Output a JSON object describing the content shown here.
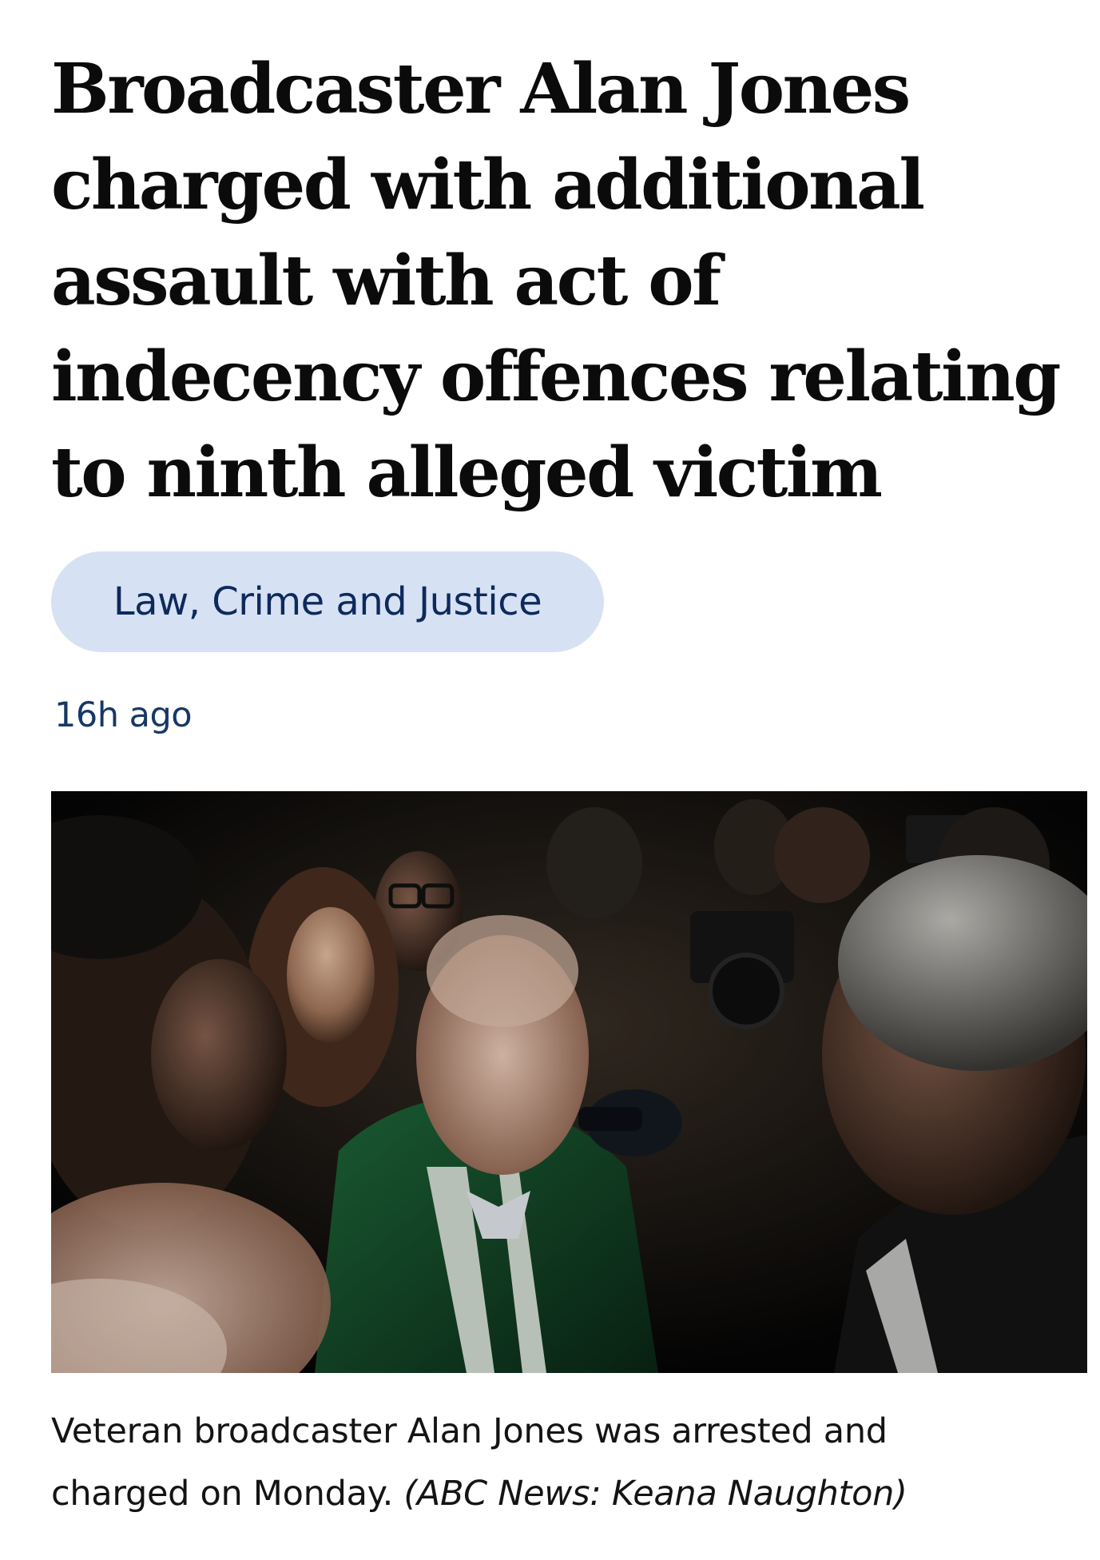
{
  "headline": {
    "lines": [
      "Broadcaster Alan Jones",
      "charged with additional",
      "assault with act of",
      "indecency offences relating",
      "to ninth alleged victim"
    ]
  },
  "topic_tag": {
    "label": "Law, Crime and Justice"
  },
  "timestamp": "16h ago",
  "photo": {
    "alt_subject": "news-photo"
  },
  "caption": {
    "line1": "Veteran broadcaster Alan Jones was arrested and",
    "line2_text": "charged on Monday.",
    "credit": "(ABC News: Keana Naughton)"
  },
  "colors": {
    "tag_background": "#d6e2f4",
    "tag_text": "#0e2a5c",
    "timestamp_text": "#173866",
    "headline_text": "#0b0b0b"
  }
}
